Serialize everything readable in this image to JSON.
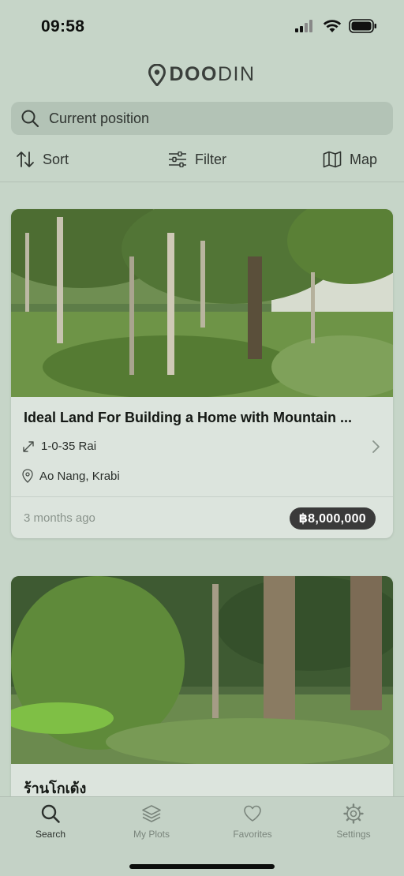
{
  "status_bar": {
    "time": "09:58"
  },
  "app": {
    "logo_bold": "DOO",
    "logo_light": "DIN"
  },
  "search": {
    "placeholder": "Current position"
  },
  "toolbar": {
    "sort_label": "Sort",
    "filter_label": "Filter",
    "map_label": "Map"
  },
  "listings": [
    {
      "title": "Ideal Land For Building a Home with Mountain ...",
      "size": "1-0-35 Rai",
      "location": "Ao Nang, Krabi",
      "posted": "3 months ago",
      "price": "฿8,000,000"
    },
    {
      "title": "ร้านโกเด้ง"
    }
  ],
  "tabs": [
    {
      "label": "Search",
      "icon": "search-icon",
      "active": true
    },
    {
      "label": "My Plots",
      "icon": "layers-icon",
      "active": false
    },
    {
      "label": "Favorites",
      "icon": "heart-icon",
      "active": false
    },
    {
      "label": "Settings",
      "icon": "gear-icon",
      "active": false
    }
  ],
  "colors": {
    "background": "#c6d5c8",
    "card": "#dce4dd",
    "price_badge": "#3a3a3a"
  }
}
